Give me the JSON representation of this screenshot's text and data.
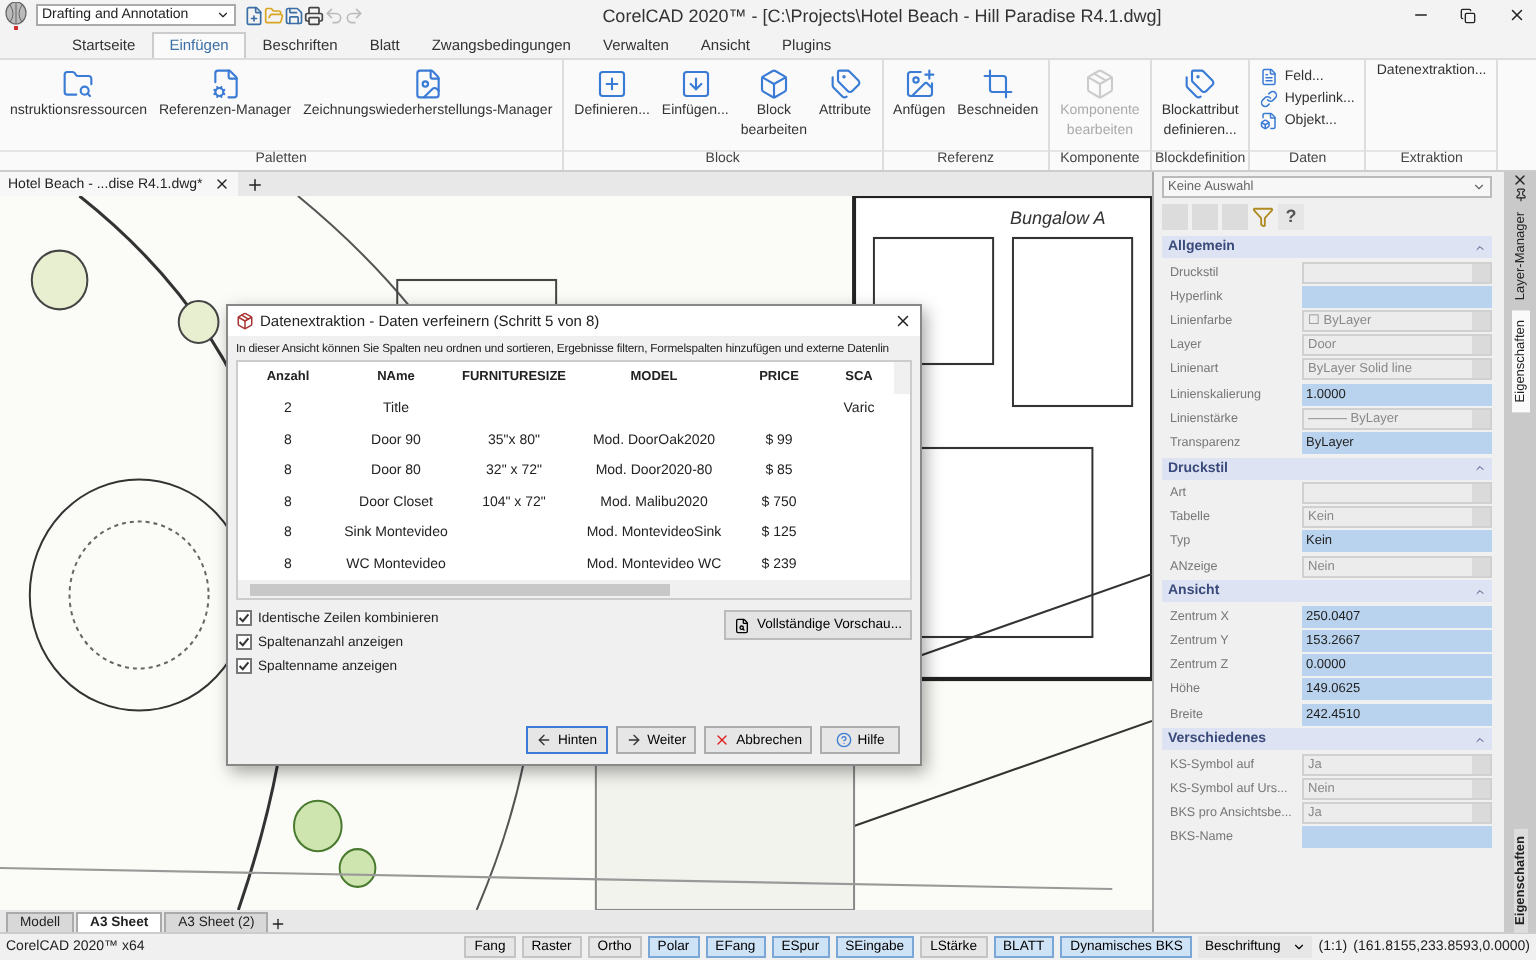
{
  "app": {
    "preset": "Drafting and Annotation",
    "title": "CorelCAD 2020™ - [C:\\Projects\\Hotel Beach - Hill Paradise R4.1.dwg]"
  },
  "ribbon_tabs": [
    {
      "label": "Startseite",
      "selected": false
    },
    {
      "label": "Einfügen",
      "selected": true
    },
    {
      "label": "Beschriften",
      "selected": false
    },
    {
      "label": "Blatt",
      "selected": false
    },
    {
      "label": "Zwangsbedingungen",
      "selected": false
    },
    {
      "label": "Verwalten",
      "selected": false
    },
    {
      "label": "Ansicht",
      "selected": false
    },
    {
      "label": "Plugins",
      "selected": false
    }
  ],
  "ribbon_groups": [
    {
      "label": "Paletten",
      "buttons": [
        {
          "kind": "large",
          "lines": [
            "nstruktionsressourcen"
          ],
          "disabled": false
        },
        {
          "kind": "large",
          "lines": [
            "Referenzen-Manager"
          ],
          "disabled": false
        },
        {
          "kind": "large",
          "lines": [
            "Zeichnungswiederherstellungs-Manager"
          ],
          "disabled": false
        }
      ]
    },
    {
      "label": "Block",
      "buttons": [
        {
          "kind": "large",
          "lines": [
            "Definieren..."
          ],
          "disabled": false
        },
        {
          "kind": "large",
          "lines": [
            "Einfügen..."
          ],
          "disabled": false
        },
        {
          "kind": "large",
          "lines": [
            "Block",
            "bearbeiten"
          ],
          "disabled": false
        },
        {
          "kind": "large",
          "lines": [
            "Attribute"
          ],
          "disabled": false
        }
      ]
    },
    {
      "label": "Referenz",
      "buttons": [
        {
          "kind": "large",
          "lines": [
            "Anfügen"
          ],
          "disabled": false
        },
        {
          "kind": "large",
          "lines": [
            "Beschneiden"
          ],
          "disabled": false
        }
      ]
    },
    {
      "label": "Komponente",
      "buttons": [
        {
          "kind": "large",
          "lines": [
            "Komponente",
            "bearbeiten"
          ],
          "disabled": true
        }
      ]
    },
    {
      "label": "Blockdefinition",
      "buttons": [
        {
          "kind": "large",
          "lines": [
            "Blockattribut",
            "definieren..."
          ],
          "disabled": false
        }
      ]
    },
    {
      "label": "Daten",
      "buttons": [
        {
          "kind": "small",
          "lines": [
            "Feld..."
          ],
          "disabled": false
        },
        {
          "kind": "small",
          "lines": [
            "Hyperlink..."
          ],
          "disabled": false
        },
        {
          "kind": "small",
          "lines": [
            "Objekt..."
          ],
          "disabled": false
        }
      ]
    },
    {
      "label": "Extraktion",
      "buttons": [
        {
          "kind": "text",
          "lines": [
            "Datenextraktion..."
          ],
          "disabled": false
        }
      ]
    }
  ],
  "document_tab": {
    "label": "Hotel Beach - ...dise R4.1.dwg*"
  },
  "drawing": {
    "label": "Bungalow A"
  },
  "dialog": {
    "title": "Datenextraktion - Daten verfeinern (Schritt 5 von 8)",
    "description": "In dieser Ansicht können Sie Spalten neu ordnen und sortieren, Ergebnisse filtern, Formelspalten hinzufügen und externe Datenlin",
    "columns": [
      "Anzahl",
      "NAme",
      "FURNITURESIZE",
      "MODEL",
      "PRICE",
      "SCA"
    ],
    "rows": [
      [
        "2",
        "Title",
        "",
        "",
        "",
        "Varic"
      ],
      [
        "8",
        "Door 90",
        "35\"x 80\"",
        "Mod. DoorOak2020",
        "$ 99",
        ""
      ],
      [
        "8",
        "Door 80",
        "32\" x 72\"",
        "Mod. Door2020-80",
        "$ 85",
        ""
      ],
      [
        "8",
        "Door Closet",
        "104\" x 72\"",
        "Mod.  Malibu2020",
        "$ 750",
        ""
      ],
      [
        "8",
        "Sink Montevideo",
        "",
        "Mod. MontevideoSink",
        "$ 125",
        ""
      ],
      [
        "8",
        "WC Montevideo",
        "",
        "Mod. Montevideo WC",
        "$ 239",
        ""
      ]
    ],
    "options": [
      {
        "label": "Identische Zeilen kombinieren",
        "checked": true
      },
      {
        "label": "Spaltenanzahl anzeigen",
        "checked": true
      },
      {
        "label": "Spaltenname anzeigen",
        "checked": true
      }
    ],
    "preview_button": "Vollständige Vorschau...",
    "buttons": [
      {
        "kind": "back",
        "label": "Hinten",
        "selected": true
      },
      {
        "kind": "next",
        "label": "Weiter",
        "selected": false
      },
      {
        "kind": "cancel",
        "label": "Abbrechen",
        "selected": false
      },
      {
        "kind": "help",
        "label": "Hilfe",
        "selected": false
      }
    ]
  },
  "properties": {
    "selection": "Keine Auswahl",
    "help_label": "?",
    "sections": [
      {
        "title": "Allgemein",
        "rows": [
          {
            "label": "Druckstil",
            "kind": "dropdown"
          },
          {
            "label": "Hyperlink",
            "kind": "field"
          },
          {
            "label": "Linienfarbe",
            "kind": "dropdown",
            "value": "☐ ByLayer"
          },
          {
            "label": "Layer",
            "kind": "dropdown",
            "value": "Door"
          },
          {
            "label": "Linienart",
            "kind": "dropdown",
            "value": "ByLayer    Solid line"
          },
          {
            "label": "Linienskalierung",
            "kind": "field",
            "value": "1.0000"
          },
          {
            "label": "Linienstärke",
            "kind": "dropdown",
            "value": "——— ByLayer"
          },
          {
            "label": "Transparenz",
            "kind": "field",
            "value": "ByLayer"
          }
        ]
      },
      {
        "title": "Druckstil",
        "rows": [
          {
            "label": "Art",
            "kind": "dropdown"
          },
          {
            "label": "Tabelle",
            "kind": "dropdown",
            "value": "Kein"
          },
          {
            "label": "Typ",
            "kind": "field",
            "value": "Kein"
          },
          {
            "label": "ANzeige",
            "kind": "dropdown",
            "value": "Nein"
          }
        ]
      },
      {
        "title": "Ansicht",
        "rows": [
          {
            "label": "Zentrum X",
            "kind": "field",
            "value": "250.0407"
          },
          {
            "label": "Zentrum Y",
            "kind": "field",
            "value": "153.2667"
          },
          {
            "label": "Zentrum Z",
            "kind": "field",
            "value": "0.0000"
          },
          {
            "label": "Höhe",
            "kind": "field",
            "value": "149.0625"
          },
          {
            "label": "Breite",
            "kind": "field",
            "value": "242.4510"
          }
        ]
      },
      {
        "title": "Verschiedenes",
        "rows": [
          {
            "label": "KS-Symbol auf",
            "kind": "dropdown",
            "value": "Ja"
          },
          {
            "label": "KS-Symbol auf Urs...",
            "kind": "dropdown",
            "value": "Nein"
          },
          {
            "label": "BKS pro Ansichtsbe...",
            "kind": "dropdown",
            "value": "Ja"
          },
          {
            "label": "BKS-Name",
            "kind": "field"
          }
        ]
      }
    ]
  },
  "side_tabs": [
    {
      "label": "Layer-Manager",
      "selected": false
    },
    {
      "label": "Eigenschaften",
      "selected": true
    }
  ],
  "side_tab_bottom": "Eigenschaften",
  "sheet_tabs": [
    {
      "label": "Modell",
      "selected": false
    },
    {
      "label": "A3 Sheet",
      "selected": true
    },
    {
      "label": "A3 Sheet (2)",
      "selected": false
    }
  ],
  "status_bar": {
    "app": "CorelCAD 2020™ x64",
    "toggles": [
      {
        "label": "Fang",
        "on": false
      },
      {
        "label": "Raster",
        "on": false
      },
      {
        "label": "Ortho",
        "on": false
      },
      {
        "label": "Polar",
        "on": true
      },
      {
        "label": "EFang",
        "on": true
      },
      {
        "label": "ESpur",
        "on": true
      },
      {
        "label": "SEingabe",
        "on": true
      },
      {
        "label": "LStärke",
        "on": false
      },
      {
        "label": "BLATT",
        "on": true
      },
      {
        "label": "Dynamisches BKS",
        "on": true
      }
    ],
    "annotation": "Beschriftung",
    "scale": "(1:1)",
    "coordinates": "(161.8155,233.8593,0.0000)"
  }
}
